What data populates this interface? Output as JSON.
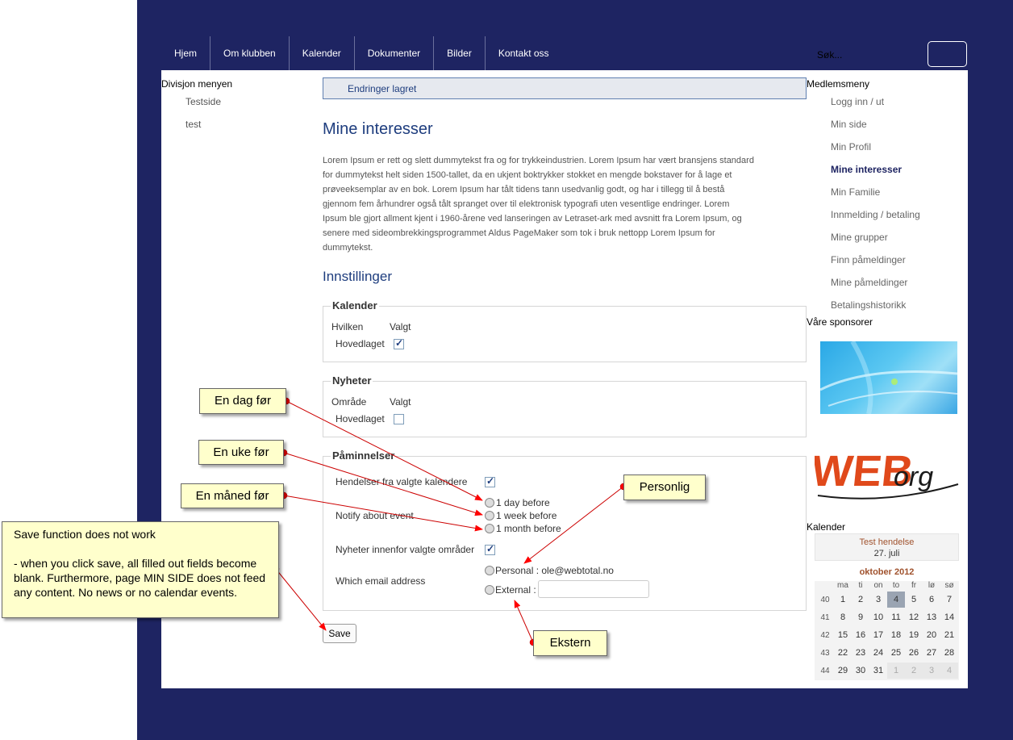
{
  "nav": {
    "items": [
      "Hjem",
      "Om klubben",
      "Kalender",
      "Dokumenter",
      "Bilder",
      "Kontakt oss"
    ],
    "search_placeholder": "Søk..."
  },
  "left": {
    "title": "Divisjon menyen",
    "links": [
      "Testside",
      "test"
    ]
  },
  "main": {
    "notice": "Endringer lagret",
    "title": "Mine interesser",
    "lorem_lines": [
      "Lorem Ipsum er rett og slett dummytekst fra og for trykkeindustrien. Lorem Ipsum har vært bransjens standard",
      "for dummytekst helt siden 1500-tallet, da en ukjent boktrykker stokket en mengde bokstaver for å lage et",
      "prøveeksemplar av en bok. Lorem Ipsum har tålt tidens tann usedvanlig godt, og har i tillegg til å bestå",
      "gjennom fem århundrer også tålt spranget over til elektronisk typografi uten vesentlige endringer. Lorem",
      "Ipsum ble gjort allment kjent i 1960-årene ved lanseringen av Letraset-ark med avsnitt fra Lorem Ipsum, og",
      "senere med sideombrekkingsprogrammet Aldus PageMaker som tok i bruk nettopp Lorem Ipsum for",
      "dummytekst."
    ],
    "settings_title": "Innstillinger",
    "kalender": {
      "legend": "Kalender",
      "col1": "Hvilken",
      "col2": "Valgt",
      "row": "Hovedlaget",
      "checked": true
    },
    "nyheter": {
      "legend": "Nyheter",
      "col1": "Område",
      "col2": "Valgt",
      "row": "Hovedlaget",
      "checked": false
    },
    "paminnelser": {
      "legend": "Påminnelser",
      "events_label": "Hendelser fra valgte kalendere",
      "events_checked": true,
      "notify_label": "Notify about event",
      "options": [
        "1 day before",
        "1 week before",
        "1 month before"
      ],
      "news_label": "Nyheter innenfor valgte områder",
      "news_checked": true,
      "email_label": "Which email address",
      "personal": "Personal : ole@webtotal.no",
      "external": "External :"
    },
    "save": "Save"
  },
  "right": {
    "member_title": "Medlemsmeny",
    "member_links": [
      "Logg inn / ut",
      "Min side",
      "Min Profil",
      "Mine interesser",
      "Min Familie",
      "Innmelding / betaling",
      "Mine grupper",
      "Finn påmeldinger",
      "Mine påmeldinger",
      "Betalingshistorikk"
    ],
    "active_link": "Mine interesser",
    "sponsors_title": "Våre sponsorer",
    "sponsor_logo_text": "WEBorg",
    "calendar_title": "Kalender",
    "event_title": "Test hendelse",
    "event_date": "27. juli",
    "month": "oktober 2012",
    "weekdays": [
      "ma",
      "ti",
      "on",
      "to",
      "fr",
      "lø",
      "sø"
    ],
    "weeks": [
      "40",
      "41",
      "42",
      "43",
      "44"
    ],
    "days": [
      [
        "1",
        "2",
        "3",
        "4",
        "5",
        "6",
        "7"
      ],
      [
        "8",
        "9",
        "10",
        "11",
        "12",
        "13",
        "14"
      ],
      [
        "15",
        "16",
        "17",
        "18",
        "19",
        "20",
        "21"
      ],
      [
        "22",
        "23",
        "24",
        "25",
        "26",
        "27",
        "28"
      ],
      [
        "29",
        "30",
        "31",
        "1",
        "2",
        "3",
        "4"
      ]
    ],
    "today": "4"
  },
  "annotations": {
    "en_dag": "En dag før",
    "en_uke": "En uke før",
    "en_maned": "En måned før",
    "personlig": "Personlig",
    "ekstern": "Ekstern",
    "save_note_title": "Save function does not work",
    "save_note_body": "- when you click save, all filled out fields become blank. Furthermore, page MIN SIDE does not feed any content. No news or no calendar events."
  },
  "colors": {
    "navy": "#1e2462",
    "heading": "#1e3d7e",
    "note_bg": "#ffffcc",
    "arrow": "#ff0000"
  }
}
